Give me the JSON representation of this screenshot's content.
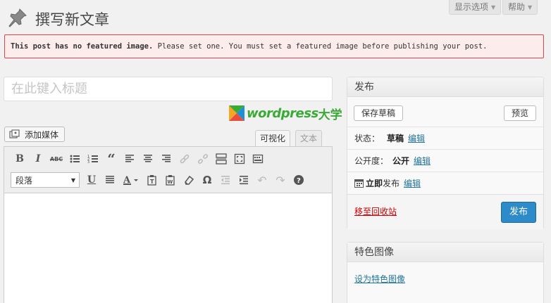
{
  "header": {
    "title": "撰写新文章",
    "screen_options": "显示选项",
    "help": "帮助"
  },
  "notice": {
    "bold": "This post has no featured image.",
    "text": " Please set one. You must set a featured image before publishing your post."
  },
  "title_input": {
    "placeholder": "在此键入标题",
    "value": ""
  },
  "logo": {
    "text": "wordpress",
    "suffix": "大学"
  },
  "media_button": {
    "label": "添加媒体"
  },
  "editor_tabs": {
    "visual": "可视化",
    "text": "文本"
  },
  "toolbar": {
    "format_select": "段落",
    "row1": [
      "bold-icon",
      "italic-icon",
      "strikethrough-icon",
      "bullet-list-icon",
      "numbered-list-icon",
      "blockquote-icon",
      "align-left-icon",
      "align-center-icon",
      "align-right-icon",
      "link-icon",
      "unlink-icon",
      "more-tag-icon",
      "fullscreen-icon",
      "toolbar-toggle-icon"
    ],
    "row2": [
      "underline-icon",
      "justify-icon",
      "text-color-icon",
      "paste-text-icon",
      "paste-word-icon",
      "clear-format-icon",
      "special-char-icon",
      "outdent-icon",
      "indent-icon",
      "undo-icon",
      "redo-icon",
      "help-icon"
    ]
  },
  "publish": {
    "title": "发布",
    "save_draft": "保存草稿",
    "preview": "预览",
    "status_label": "状态：",
    "status_value": "草稿",
    "visibility_label": "公开度：",
    "visibility_value": "公开",
    "schedule_value": "立即",
    "schedule_suffix": "发布",
    "edit": "编辑",
    "trash": "移至回收站",
    "publish_button": "发布"
  },
  "featured": {
    "title": "特色图像",
    "set_link": "设为特色图像"
  },
  "colors": {
    "accent": "#2e8bc9",
    "link": "#21759b",
    "error": "#cc0000",
    "logo_green": "#3aaa35"
  }
}
